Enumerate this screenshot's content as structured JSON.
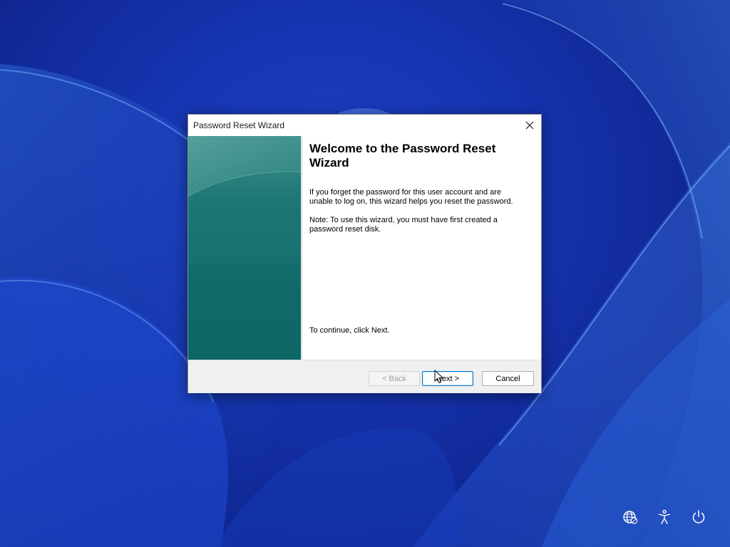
{
  "dialog": {
    "title": "Password Reset Wizard",
    "heading": "Welcome to the Password Reset Wizard",
    "paragraph1": "If you forget the password for this user account and are unable to log on, this wizard helps you reset the password.",
    "paragraph2": "Note: To use this wizard, you must have first created a password reset disk.",
    "continue_text": "To continue, click Next.",
    "buttons": {
      "back": "< Back",
      "next": "Next >",
      "cancel": "Cancel"
    },
    "back_enabled": false,
    "focused_button": "next"
  },
  "system_tray": {
    "icons": [
      "network-icon",
      "accessibility-icon",
      "power-icon"
    ]
  },
  "colors": {
    "wallpaper": "#1634b0",
    "sidebar_teal": "#0f6e6e",
    "focus_border": "#0078d4"
  }
}
